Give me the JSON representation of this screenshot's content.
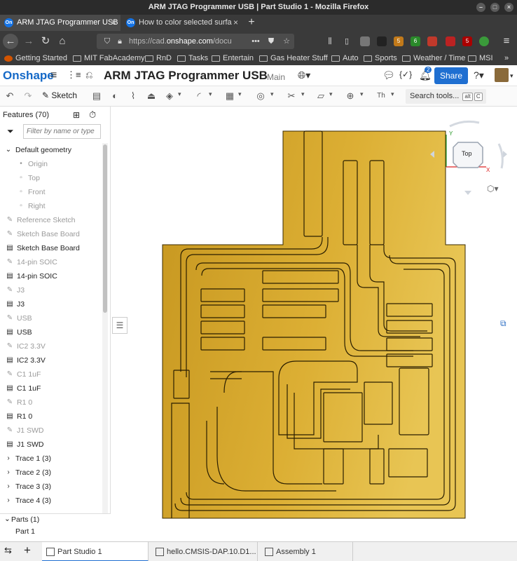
{
  "window": {
    "title": "ARM JTAG Programmer USB | Part Studio 1 - Mozilla Firefox"
  },
  "browser_tabs": [
    {
      "label": "ARM JTAG Programmer USB",
      "favicon": "On"
    },
    {
      "label": "How to color selected surfa",
      "favicon": "On"
    }
  ],
  "url": {
    "prefix": "https://cad.",
    "host": "onshape.com",
    "rest": "/docu"
  },
  "extension_badges": [
    "5",
    "6",
    "5"
  ],
  "bookmarks": [
    "Getting Started",
    "MIT FabAcademy",
    "RnD",
    "Tasks",
    "Entertain",
    "Gas Heater Stuff",
    "Auto",
    "Sports",
    "Weather / Time",
    "MSI"
  ],
  "app": {
    "logo": "Onshape",
    "doc_title": "ARM JTAG Programmer USB",
    "branch": "Main",
    "share": "Share",
    "notifications": "2"
  },
  "toolbar": {
    "sketch": "Sketch",
    "search": "Search tools...",
    "kbd_alt": "alt",
    "kbd_c": "C"
  },
  "view_cube": {
    "face": "Top",
    "y_axis": "Y",
    "x_axis": "X"
  },
  "features": {
    "title": "Features (70)",
    "filter_placeholder": "Filter by name or type",
    "items": [
      {
        "label": "Default geometry",
        "icon": "chevron-down-icon",
        "indent": 0,
        "dim": false
      },
      {
        "label": "Origin",
        "icon": "origin-icon",
        "indent": 2,
        "dim": true
      },
      {
        "label": "Top",
        "icon": "plane-icon",
        "indent": 2,
        "dim": true
      },
      {
        "label": "Front",
        "icon": "plane-icon",
        "indent": 2,
        "dim": true
      },
      {
        "label": "Right",
        "icon": "plane-icon",
        "indent": 2,
        "dim": true
      },
      {
        "label": "Reference Sketch",
        "icon": "sketch-icon",
        "indent": 1,
        "dim": true
      },
      {
        "label": "Sketch Base Board",
        "icon": "sketch-icon",
        "indent": 1,
        "dim": true
      },
      {
        "label": "Sketch Base Board",
        "icon": "extrude-icon",
        "indent": 1,
        "dim": false
      },
      {
        "label": "14-pin SOIC",
        "icon": "sketch-icon",
        "indent": 1,
        "dim": true
      },
      {
        "label": "14-pin SOIC",
        "icon": "extrude-icon",
        "indent": 1,
        "dim": false
      },
      {
        "label": "J3",
        "icon": "sketch-icon",
        "indent": 1,
        "dim": true
      },
      {
        "label": "J3",
        "icon": "extrude-icon",
        "indent": 1,
        "dim": false
      },
      {
        "label": "USB",
        "icon": "sketch-icon",
        "indent": 1,
        "dim": true
      },
      {
        "label": "USB",
        "icon": "extrude-icon",
        "indent": 1,
        "dim": false
      },
      {
        "label": "IC2 3.3V",
        "icon": "sketch-icon",
        "indent": 1,
        "dim": true
      },
      {
        "label": "IC2 3.3V",
        "icon": "extrude-icon",
        "indent": 1,
        "dim": false
      },
      {
        "label": "C1 1uF",
        "icon": "sketch-icon",
        "indent": 1,
        "dim": true
      },
      {
        "label": "C1 1uF",
        "icon": "extrude-icon",
        "indent": 1,
        "dim": false
      },
      {
        "label": "R1 0",
        "icon": "sketch-icon",
        "indent": 1,
        "dim": true
      },
      {
        "label": "R1 0",
        "icon": "extrude-icon",
        "indent": 1,
        "dim": false
      },
      {
        "label": "J1 SWD",
        "icon": "sketch-icon",
        "indent": 1,
        "dim": true
      },
      {
        "label": "J1 SWD",
        "icon": "extrude-icon",
        "indent": 1,
        "dim": false
      },
      {
        "label": "Trace 1 (3)",
        "icon": "chevron-right-icon",
        "indent": 0,
        "dim": false
      },
      {
        "label": "Trace 2 (3)",
        "icon": "chevron-right-icon",
        "indent": 0,
        "dim": false
      },
      {
        "label": "Trace 3 (3)",
        "icon": "chevron-right-icon",
        "indent": 0,
        "dim": false
      },
      {
        "label": "Trace 4 (3)",
        "icon": "chevron-right-icon",
        "indent": 0,
        "dim": false
      }
    ]
  },
  "parts": {
    "title": "Parts (1)",
    "items": [
      "Part 1"
    ]
  },
  "bottom_tabs": [
    {
      "label": "Part Studio 1",
      "active": true
    },
    {
      "label": "hello.CMSIS-DAP.10.D1...",
      "active": false
    },
    {
      "label": "Assembly 1",
      "active": false
    }
  ],
  "colors": {
    "board_gold": "#d2a62a",
    "accent": "#1f6fd1"
  }
}
